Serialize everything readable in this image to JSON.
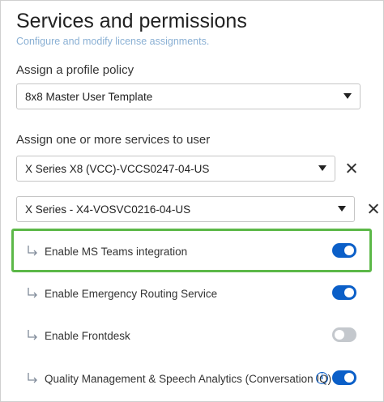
{
  "header": {
    "title": "Services and permissions",
    "subtitle": "Configure and modify license assignments."
  },
  "profile_policy": {
    "label": "Assign a profile policy",
    "selected": "8x8 Master User Template"
  },
  "services": {
    "label": "Assign one or more services to user",
    "selected": [
      "X Series X8 (VCC)-VCCS0247-04-US",
      "X Series - X4-VOSVC0216-04-US"
    ]
  },
  "features": [
    {
      "label": "Enable MS Teams integration",
      "enabled": true,
      "highlighted": true
    },
    {
      "label": "Enable Emergency Routing Service",
      "enabled": true
    },
    {
      "label": "Enable Frontdesk",
      "enabled": false
    },
    {
      "label": "Quality Management & Speech Analytics (Conversation IQ)",
      "enabled": true,
      "info_icon": "info-icon"
    }
  ],
  "colors": {
    "accent": "#0b5fc8",
    "highlight_border": "#5cb848",
    "toggle_off": "#c4c8cd",
    "subtitle": "#8ab0d4"
  },
  "icons": {
    "remove": "close-icon",
    "dropdown": "chevron-down-icon",
    "sub_item": "subdirectory-arrow-icon"
  }
}
